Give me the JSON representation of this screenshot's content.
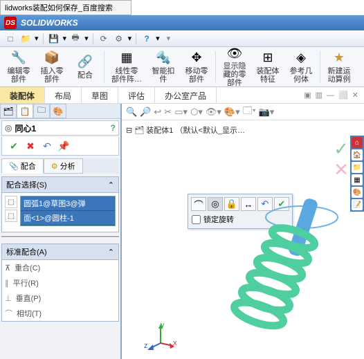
{
  "browser_tab": "lidworks装配如何保存_百度搜索",
  "app_title": "SOLIDWORKS",
  "qat": {
    "new": "□",
    "open": "📁",
    "save": "💾",
    "print": "🖶",
    "rebuild": "⟳",
    "options": "⚙",
    "help": "?"
  },
  "ribbon": {
    "edit_component": "编辑零\n部件",
    "insert_component": "插入零\n部件",
    "mate": "配合",
    "linear_pattern": "线性零\n部件阵…",
    "smart_fasteners": "智能扣\n件",
    "move_component": "移动零\n部件",
    "show_hidden": "显示隐\n藏的零\n部件",
    "assembly_features": "装配体\n特征",
    "ref_geometry": "参考几\n何体",
    "new_motion": "新建运\n动算例"
  },
  "tabs": {
    "assembly": "装配体",
    "layout": "布局",
    "sketch": "草图",
    "evaluate": "评估",
    "office": "办公室产品"
  },
  "prop": {
    "title": "同心1",
    "ok": "✔",
    "cancel": "✖",
    "undo": "↶",
    "pushpin": "📌",
    "sub_mate": "配合",
    "sub_analysis": "分析",
    "sel_header": "配合选择(S)",
    "sel1": "圆弧1@草图3@弹",
    "sel2": "面<1>@圆柱-1",
    "std_header": "标准配合(A)",
    "coincident": "重合(C)",
    "parallel": "平行(R)",
    "perpendicular": "垂直(P)",
    "tangent": "相切(T)"
  },
  "tree": "装配体1 （默认<默认_显示…",
  "float": {
    "lock_rotation": "锁定旋转"
  },
  "triad": {
    "x": "x",
    "y": "y",
    "z": "z"
  }
}
